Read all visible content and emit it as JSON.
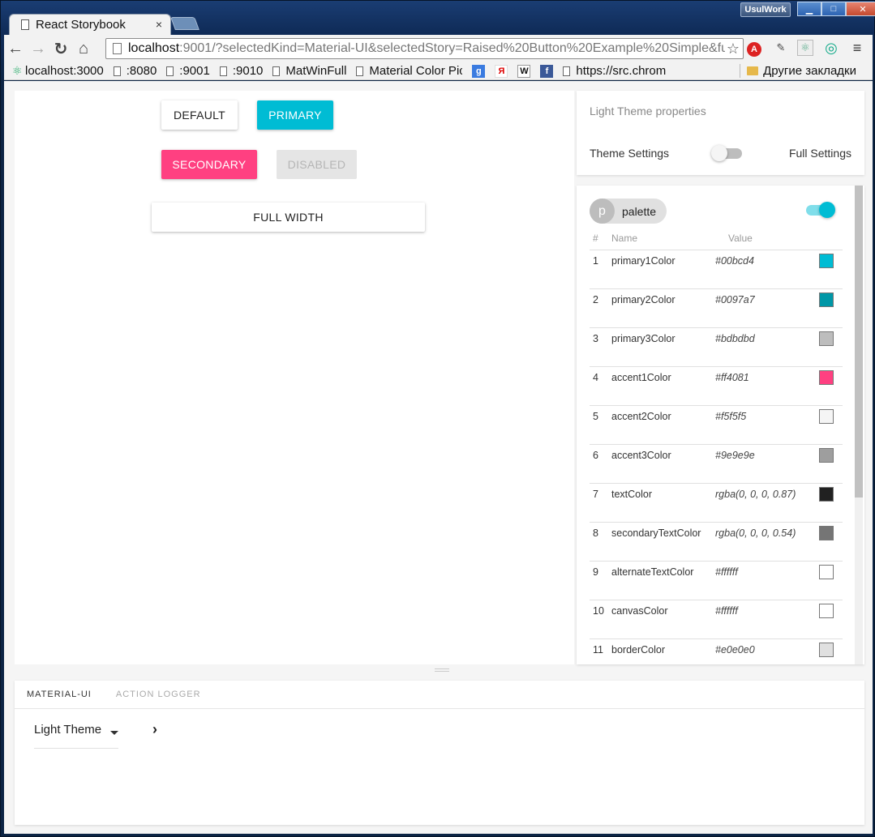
{
  "browser": {
    "tab_title": "React Storybook",
    "tab_close": "×",
    "account": "UsulWork",
    "url_host": "localhost",
    "url_rest": ":9001/?selectedKind=Material-UI&selectedStory=Raised%20Button%20Example%20Simple&fu",
    "bookmarks": [
      {
        "label": "localhost:3000"
      },
      {
        "label": ":8080"
      },
      {
        "label": ":9001"
      },
      {
        "label": ":9010"
      },
      {
        "label": "MatWinFull"
      },
      {
        "label": "Material Color Pic"
      },
      {
        "label": "https://src.chrom"
      }
    ],
    "other_bookmarks": "Другие закладки"
  },
  "preview": {
    "default": "DEFAULT",
    "primary": "PRIMARY",
    "secondary": "SECONDARY",
    "disabled": "DISABLED",
    "full_width": "FULL WIDTH"
  },
  "theme_panel": {
    "title": "Light Theme properties",
    "theme_settings": "Theme Settings",
    "full_settings": "Full Settings"
  },
  "palette": {
    "avatar": "p",
    "chip_label": "palette",
    "headers": {
      "num": "#",
      "name": "Name",
      "value": "Value"
    },
    "rows": [
      {
        "num": "1",
        "name": "primary1Color",
        "value": "#00bcd4",
        "color": "#00bcd4"
      },
      {
        "num": "2",
        "name": "primary2Color",
        "value": "#0097a7",
        "color": "#0097a7"
      },
      {
        "num": "3",
        "name": "primary3Color",
        "value": "#bdbdbd",
        "color": "#bdbdbd"
      },
      {
        "num": "4",
        "name": "accent1Color",
        "value": "#ff4081",
        "color": "#ff4081"
      },
      {
        "num": "5",
        "name": "accent2Color",
        "value": "#f5f5f5",
        "color": "#f5f5f5"
      },
      {
        "num": "6",
        "name": "accent3Color",
        "value": "#9e9e9e",
        "color": "#9e9e9e"
      },
      {
        "num": "7",
        "name": "textColor",
        "value": "rgba(0, 0, 0, 0.87)",
        "color": "#212121"
      },
      {
        "num": "8",
        "name": "secondaryTextColor",
        "value": "rgba(0, 0, 0, 0.54)",
        "color": "#757575"
      },
      {
        "num": "9",
        "name": "alternateTextColor",
        "value": "#ffffff",
        "color": "#ffffff"
      },
      {
        "num": "10",
        "name": "canvasColor",
        "value": "#ffffff",
        "color": "#ffffff"
      },
      {
        "num": "11",
        "name": "borderColor",
        "value": "#e0e0e0",
        "color": "#e0e0e0"
      }
    ]
  },
  "addons": {
    "tabs": [
      "MATERIAL-UI",
      "ACTION LOGGER"
    ],
    "theme_select": "Light Theme"
  },
  "colors": {
    "primary": "#00bcd4",
    "accent": "#ff4081"
  }
}
